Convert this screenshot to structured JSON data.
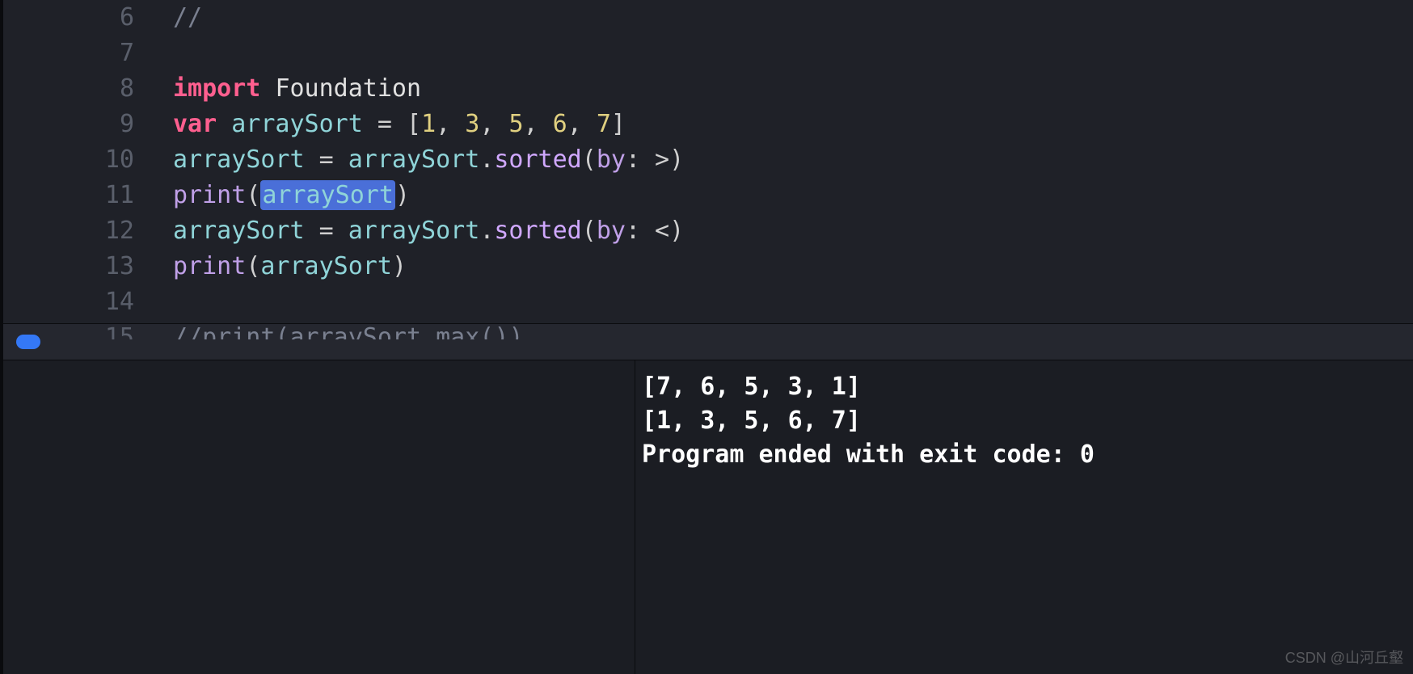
{
  "editor": {
    "lines": [
      {
        "num": "6",
        "tokens": [
          {
            "t": "//",
            "c": "tk-comment"
          }
        ]
      },
      {
        "num": "7",
        "tokens": []
      },
      {
        "num": "8",
        "tokens": [
          {
            "t": "import",
            "c": "tk-keyword"
          },
          {
            "t": " ",
            "c": ""
          },
          {
            "t": "Foundation",
            "c": "tk-type"
          }
        ]
      },
      {
        "num": "9",
        "tokens": [
          {
            "t": "var",
            "c": "tk-keyword2"
          },
          {
            "t": " ",
            "c": ""
          },
          {
            "t": "arraySort",
            "c": "tk-identifier"
          },
          {
            "t": " = [",
            "c": "tk-punctuation"
          },
          {
            "t": "1",
            "c": "tk-number"
          },
          {
            "t": ", ",
            "c": "tk-punctuation"
          },
          {
            "t": "3",
            "c": "tk-number"
          },
          {
            "t": ", ",
            "c": "tk-punctuation"
          },
          {
            "t": "5",
            "c": "tk-number"
          },
          {
            "t": ", ",
            "c": "tk-punctuation"
          },
          {
            "t": "6",
            "c": "tk-number"
          },
          {
            "t": ", ",
            "c": "tk-punctuation"
          },
          {
            "t": "7",
            "c": "tk-number"
          },
          {
            "t": "]",
            "c": "tk-punctuation"
          }
        ]
      },
      {
        "num": "10",
        "tokens": [
          {
            "t": "arraySort",
            "c": "tk-identifier"
          },
          {
            "t": " = ",
            "c": "tk-punctuation"
          },
          {
            "t": "arraySort",
            "c": "tk-identifier"
          },
          {
            "t": ".",
            "c": "tk-punctuation"
          },
          {
            "t": "sorted",
            "c": "tk-method"
          },
          {
            "t": "(",
            "c": "tk-punctuation"
          },
          {
            "t": "by",
            "c": "tk-param"
          },
          {
            "t": ": >)",
            "c": "tk-punctuation"
          }
        ]
      },
      {
        "num": "11",
        "tokens": [
          {
            "t": "print",
            "c": "tk-print"
          },
          {
            "t": "(",
            "c": "tk-punctuation"
          },
          {
            "t": "arraySort",
            "c": "tk-identifier",
            "highlight": true
          },
          {
            "t": ")",
            "c": "tk-punctuation"
          }
        ]
      },
      {
        "num": "12",
        "tokens": [
          {
            "t": "arraySort",
            "c": "tk-identifier"
          },
          {
            "t": " = ",
            "c": "tk-punctuation"
          },
          {
            "t": "arraySort",
            "c": "tk-identifier"
          },
          {
            "t": ".",
            "c": "tk-punctuation"
          },
          {
            "t": "sorted",
            "c": "tk-method"
          },
          {
            "t": "(",
            "c": "tk-punctuation"
          },
          {
            "t": "by",
            "c": "tk-param"
          },
          {
            "t": ": <)",
            "c": "tk-punctuation"
          }
        ]
      },
      {
        "num": "13",
        "tokens": [
          {
            "t": "print",
            "c": "tk-print"
          },
          {
            "t": "(",
            "c": "tk-punctuation"
          },
          {
            "t": "arraySort",
            "c": "tk-identifier"
          },
          {
            "t": ")",
            "c": "tk-punctuation"
          }
        ]
      },
      {
        "num": "14",
        "tokens": []
      }
    ],
    "partial_line": {
      "num": "15",
      "tokens": [
        {
          "t": "//print(arraySort.max())",
          "c": "tk-comment"
        }
      ]
    }
  },
  "console": {
    "lines": [
      "[7, 6, 5, 3, 1]",
      "[1, 3, 5, 6, 7]",
      "Program ended with exit code: 0"
    ]
  },
  "watermark": "CSDN @山河丘壑"
}
